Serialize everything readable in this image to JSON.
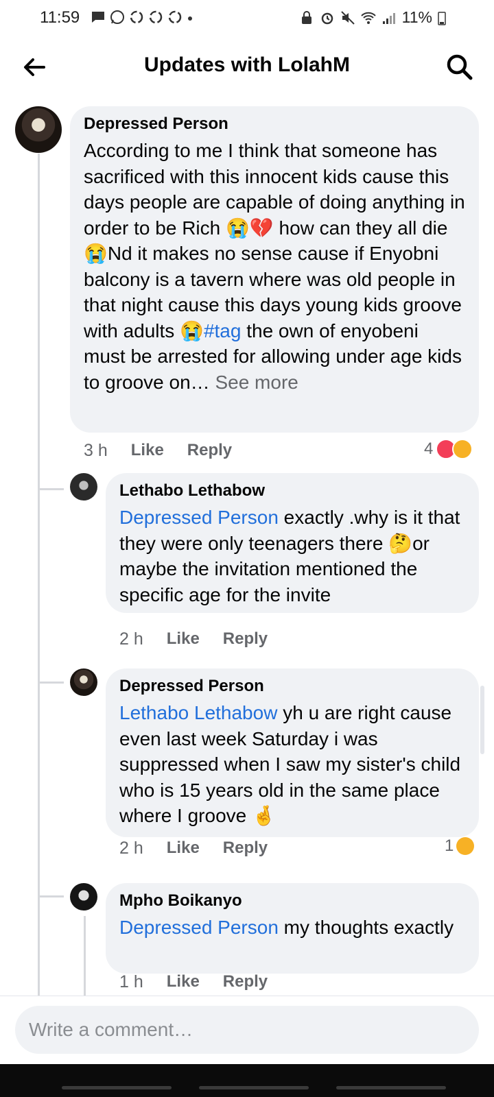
{
  "status_bar": {
    "time": "11:59",
    "battery": "11%"
  },
  "header": {
    "title": "Updates with LolahM"
  },
  "comments": [
    {
      "author": "Depressed Person",
      "text_parts": [
        "According to me I think that someone has sacrificed with this innocent kids cause this days people are capable of doing anything in order to be Rich 😭💔 how can they all die 😭Nd it makes no sense cause if Enyobni balcony is a tavern where was old people in that night cause this days young kids groove with adults 😭",
        "#tag",
        " the own of enyobeni must be arrested for allowing under age kids to groove on… ",
        "See more"
      ],
      "time": "3 h",
      "like": "Like",
      "reply": "Reply",
      "reaction_count": "4"
    },
    {
      "author": "Lethabo Lethabow",
      "mention": "Depressed Person",
      "text": " exactly .why is it that they were only teenagers there 🤔or maybe the invitation mentioned the specific age for the invite",
      "time": "2 h",
      "like": "Like",
      "reply": "Reply"
    },
    {
      "author": "Depressed Person",
      "mention": "Lethabo Lethabow",
      "text": "  yh u are right cause even last week Saturday i was suppressed when I saw my sister's child who is 15 years old in the same place where I groove 🤞",
      "time": "2 h",
      "like": "Like",
      "reply": "Reply",
      "reaction_count": "1"
    },
    {
      "author": "Mpho Boikanyo",
      "mention": "Depressed Person",
      "text": " my thoughts exactly",
      "time": "1 h",
      "like": "Like",
      "reply": "Reply"
    }
  ],
  "composer": {
    "placeholder": "Write a comment…"
  },
  "colors": {
    "mention": "#216fdb",
    "bubble": "#f0f2f5",
    "meta": "#65676b"
  }
}
